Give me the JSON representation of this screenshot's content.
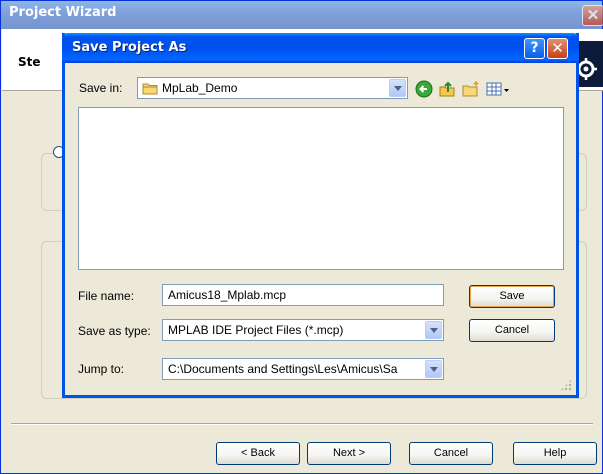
{
  "wizard": {
    "title": "Project Wizard",
    "step_label": "Ste",
    "close_glyph": "✕",
    "buttons": {
      "back": "< Back",
      "next": "Next >",
      "cancel": "Cancel",
      "help": "Help"
    }
  },
  "dialog": {
    "title": "Save Project As",
    "help_glyph": "?",
    "close_glyph": "✕",
    "save_in": {
      "label": "Save in:",
      "value": "MpLab_Demo"
    },
    "toolbar_icons": [
      "back-icon",
      "up-folder-icon",
      "new-folder-icon",
      "views-menu-icon"
    ],
    "file_name": {
      "label": "File name:",
      "value": "Amicus18_Mplab.mcp"
    },
    "save_as_type": {
      "label": "Save as type:",
      "value": "MPLAB IDE Project Files (*.mcp)"
    },
    "jump_to": {
      "label": "Jump to:",
      "value": "C:\\Documents and Settings\\Les\\Amicus\\Sa"
    },
    "buttons": {
      "save": "Save",
      "cancel": "Cancel"
    }
  },
  "colors": {
    "titlebar": "#0054e3",
    "dialog_bg": "#ece9d8",
    "close_red": "#c5401c",
    "field_border": "#7f9db9"
  }
}
